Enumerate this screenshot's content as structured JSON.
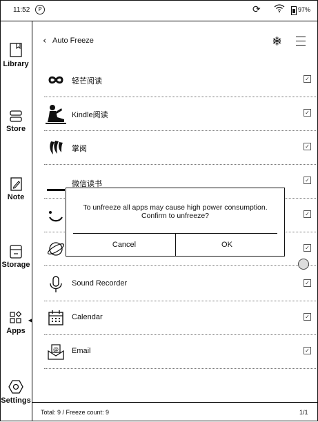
{
  "status_bar": {
    "time": "11:52",
    "battery": "97%",
    "notification_glyph": "P"
  },
  "sidebar": {
    "items": [
      {
        "label": "Library",
        "icon": "library-icon"
      },
      {
        "label": "Store",
        "icon": "store-icon"
      },
      {
        "label": "Note",
        "icon": "note-icon"
      },
      {
        "label": "Storage",
        "icon": "storage-icon"
      },
      {
        "label": "Apps",
        "icon": "apps-icon"
      },
      {
        "label": "Settings",
        "icon": "settings-icon"
      }
    ]
  },
  "header": {
    "title": "Auto Freeze"
  },
  "apps": [
    {
      "name": "轻芒阅读",
      "checked": true,
      "icon": "infinity-icon"
    },
    {
      "name": "Kindle阅读",
      "checked": true,
      "icon": "kindle-icon"
    },
    {
      "name": "掌阅",
      "checked": true,
      "icon": "ireader-icon"
    },
    {
      "name": "微信读书",
      "checked": true,
      "icon": "weread-icon"
    },
    {
      "name": "",
      "checked": true,
      "icon": "smiley-icon"
    },
    {
      "name": "",
      "checked": true,
      "icon": "browser-icon"
    },
    {
      "name": "Sound Recorder",
      "checked": true,
      "icon": "microphone-icon"
    },
    {
      "name": "Calendar",
      "checked": true,
      "icon": "calendar-icon"
    },
    {
      "name": "Email",
      "checked": true,
      "icon": "email-icon"
    }
  ],
  "dialog": {
    "message": "To unfreeze all apps may cause high power consumption. Confirm to unfreeze?",
    "cancel_label": "Cancel",
    "ok_label": "OK"
  },
  "footer": {
    "summary": "Total: 9 / Freeze count: 9",
    "page": "1/1"
  }
}
